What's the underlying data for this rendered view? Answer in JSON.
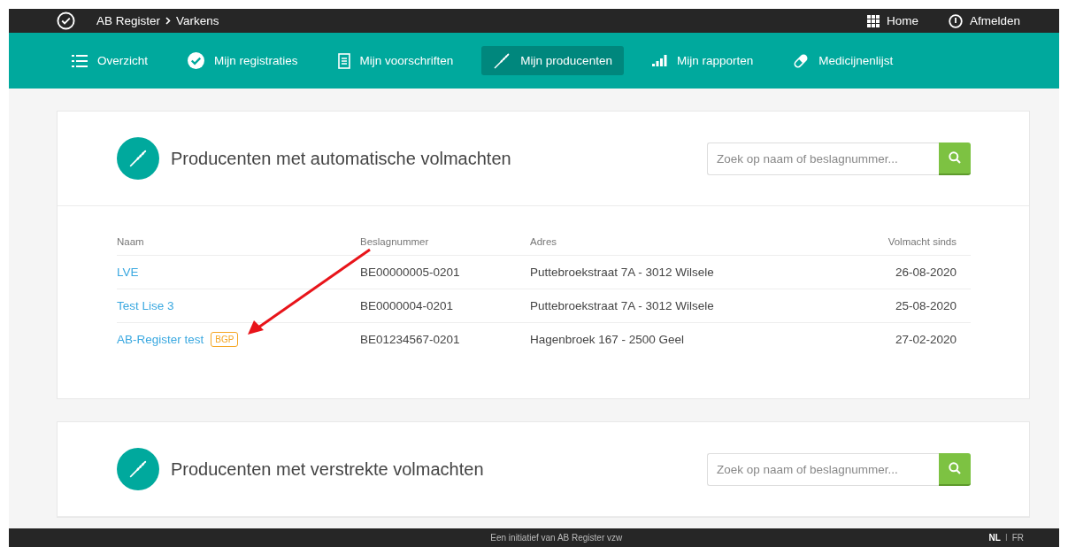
{
  "topbar": {
    "breadcrumb": [
      "AB Register",
      "Varkens"
    ],
    "links": [
      "Home",
      "Afmelden"
    ]
  },
  "nav": [
    {
      "label": "Overzicht",
      "selected": false
    },
    {
      "label": "Mijn registraties",
      "selected": false
    },
    {
      "label": "Mijn voorschriften",
      "selected": false
    },
    {
      "label": "Mijn producenten",
      "selected": true
    },
    {
      "label": "Mijn rapporten",
      "selected": false
    },
    {
      "label": "Medicijnenlijst",
      "selected": false
    }
  ],
  "sections": [
    {
      "title": "Producenten met automatische volmachten",
      "search": {
        "placeholder": "Zoek op naam of beslagnummer..."
      },
      "table": {
        "columns": [
          "Naam",
          "Beslagnummer",
          "Adres",
          "Volmacht sinds"
        ],
        "rows": [
          {
            "name": "LVE",
            "number": "BE00000005-0201",
            "address": "Puttebroekstraat 7A - 3012 Wilsele",
            "since": "26-08-2020"
          },
          {
            "name": "Test Lise 3",
            "number": "BE0000004-0201",
            "address": "Puttebroekstraat 7A - 3012 Wilsele",
            "since": "25-08-2020"
          },
          {
            "name": "AB-Register test",
            "badge": "BGP",
            "number": "BE01234567-0201",
            "address": "Hagenbroek 167 - 2500 Geel",
            "since": "27-02-2020"
          }
        ]
      }
    },
    {
      "title": "Producenten met verstrekte volmachten",
      "search": {
        "placeholder": "Zoek op naam of beslagnummer..."
      }
    }
  ],
  "footer": {
    "text": "Een initiatief van AB Register vzw",
    "languages": [
      {
        "label": "NL",
        "selected": true
      },
      {
        "label": "FR",
        "selected": false
      }
    ],
    "separator": "I"
  }
}
